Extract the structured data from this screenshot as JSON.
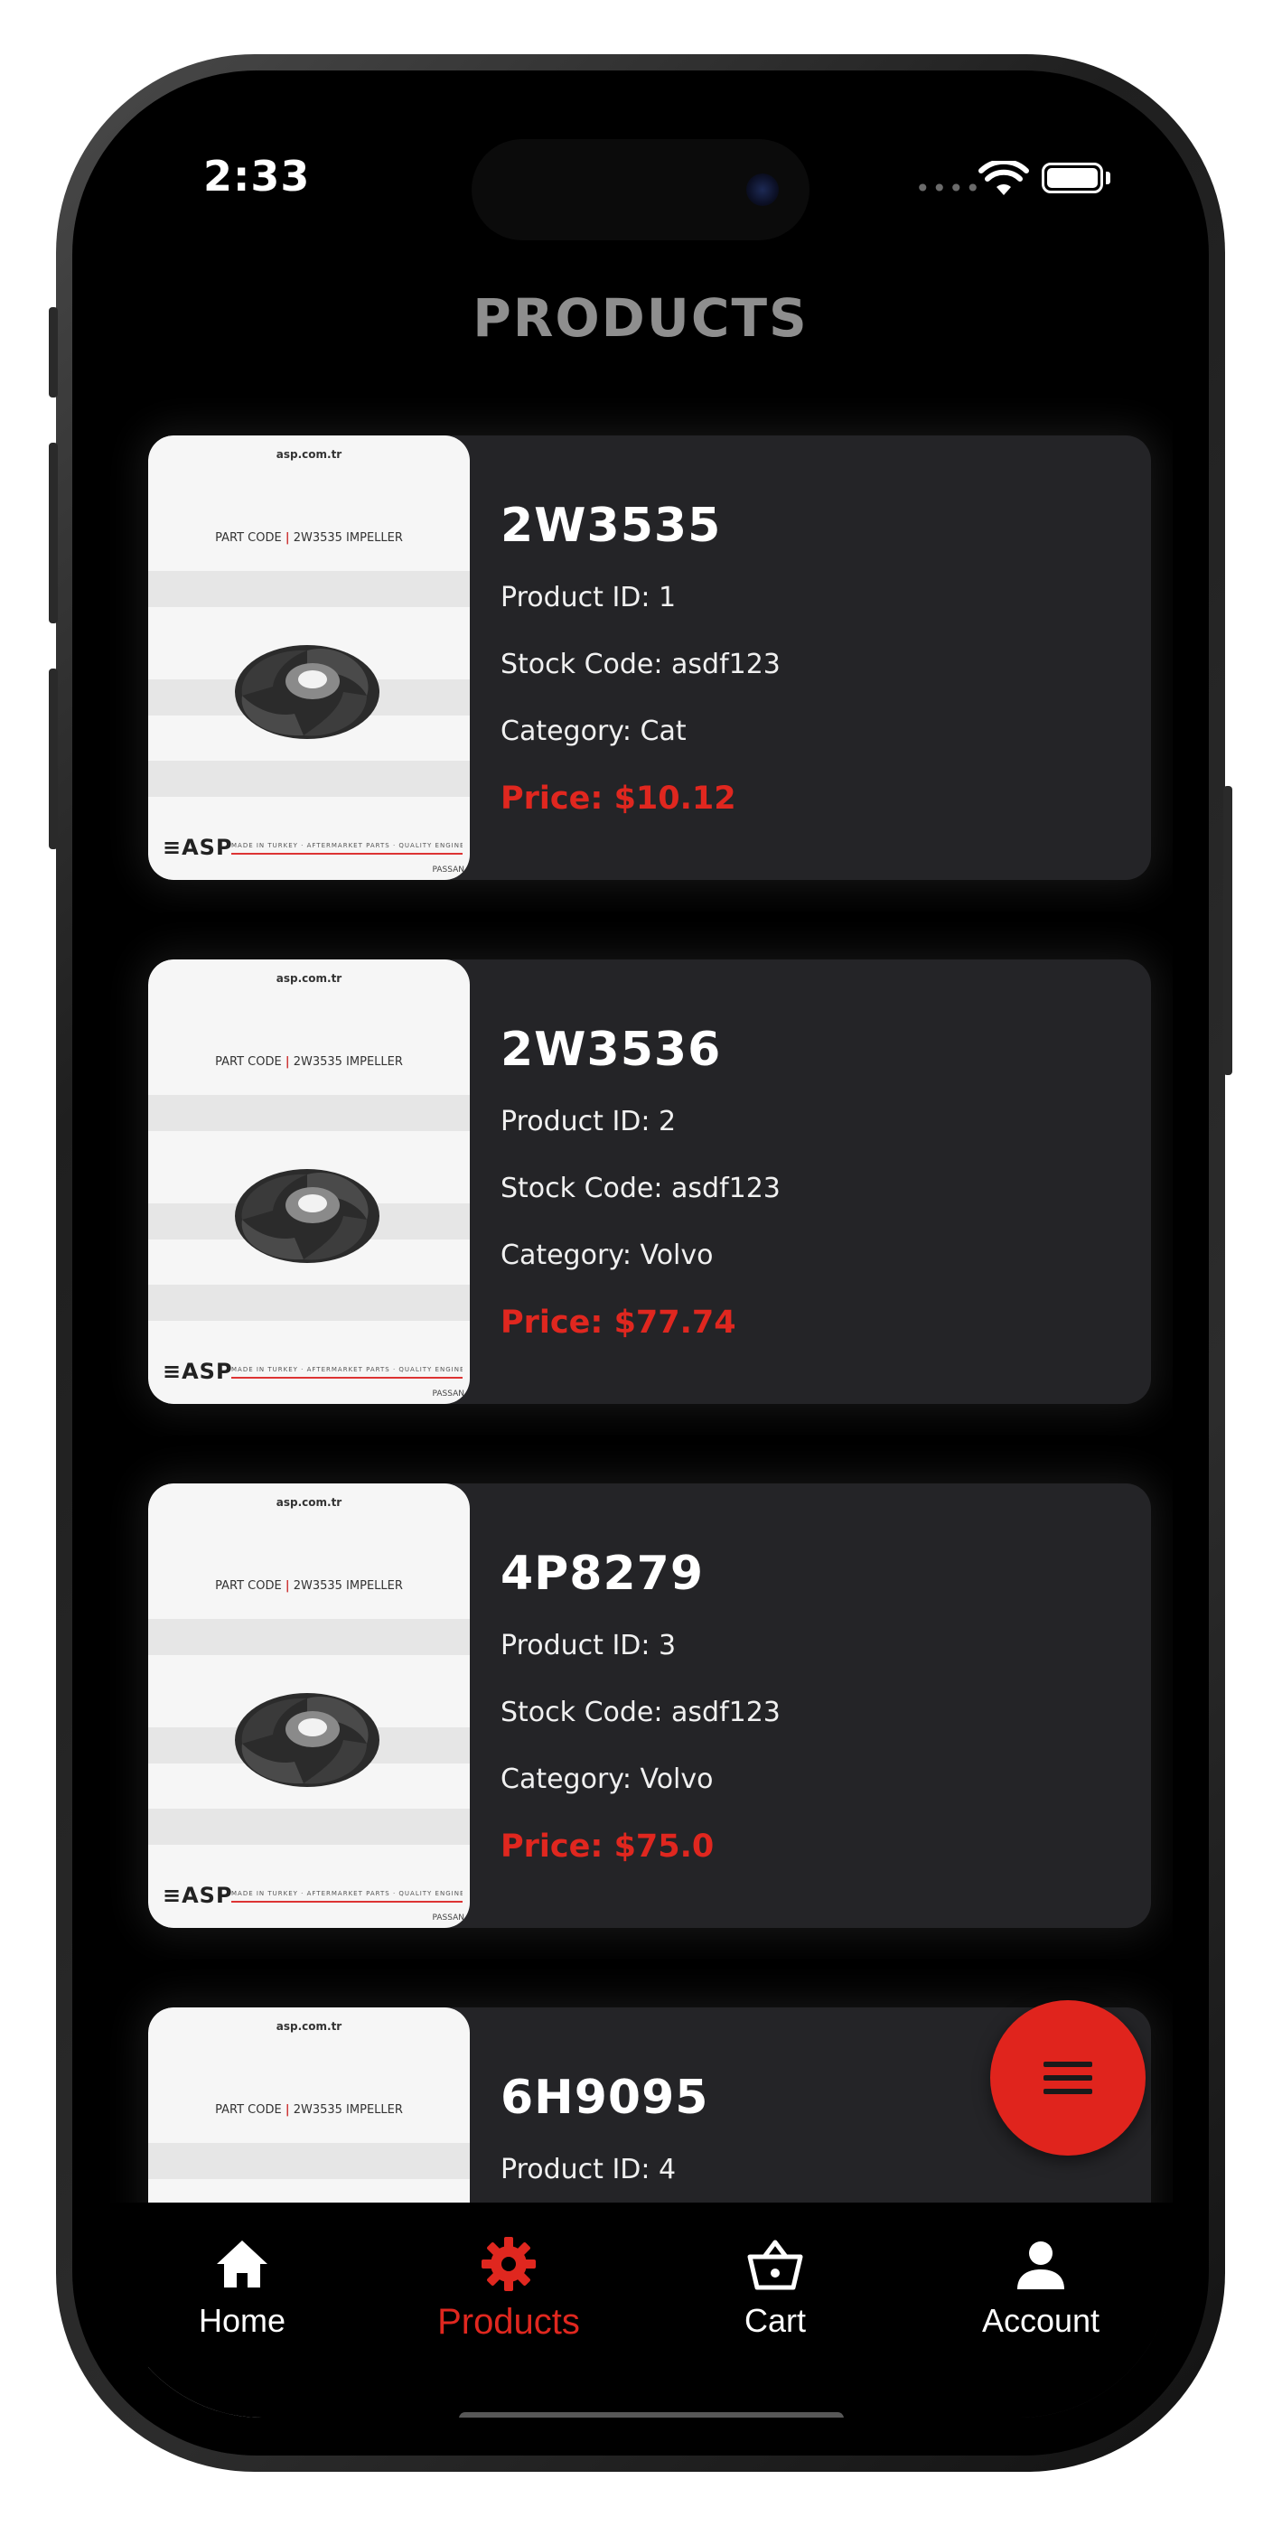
{
  "status_bar": {
    "time": "2:33",
    "signal": "••••"
  },
  "header": {
    "title": "PRODUCTS"
  },
  "thumbnail": {
    "logo_text": "asp.com.tr",
    "part_code_label": "PART CODE",
    "part_code_value": "2W3535 IMPELLER",
    "brand": "ASP",
    "footer_text": "MADE IN TURKEY · AFTERMARKET PARTS · QUALITY ENGINE COMPONENTS",
    "maker": "PASSAN"
  },
  "products": [
    {
      "name": "2W3535",
      "product_id": "Product ID: 1",
      "stock_code": "Stock Code: asdf123",
      "category": "Category: Cat",
      "price": "Price: $10.12"
    },
    {
      "name": "2W3536",
      "product_id": "Product ID: 2",
      "stock_code": "Stock Code: asdf123",
      "category": "Category: Volvo",
      "price": "Price: $77.74"
    },
    {
      "name": "4P8279",
      "product_id": "Product ID: 3",
      "stock_code": "Stock Code: asdf123",
      "category": "Category: Volvo",
      "price": "Price: $75.0"
    },
    {
      "name": "6H9095",
      "product_id": "Product ID: 4",
      "stock_code": "",
      "category": "",
      "price": ""
    }
  ],
  "fab": {
    "icon": "menu-icon"
  },
  "tabs": [
    {
      "label": "Home",
      "icon": "home-icon",
      "active": false
    },
    {
      "label": "Products",
      "icon": "gear-icon",
      "active": true
    },
    {
      "label": "Cart",
      "icon": "basket-icon",
      "active": false
    },
    {
      "label": "Account",
      "icon": "person-icon",
      "active": false
    }
  ],
  "colors": {
    "accent": "#e0271f",
    "background": "#000000",
    "card": "#242427",
    "title": "#8e8e8e"
  }
}
